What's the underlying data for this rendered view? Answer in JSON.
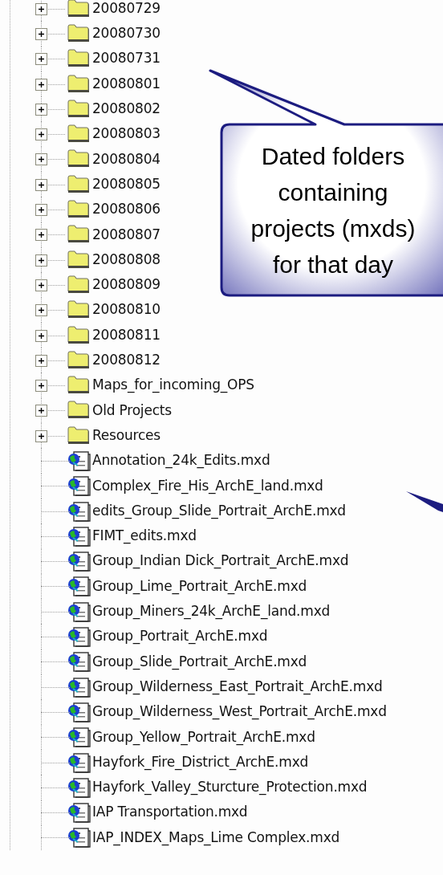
{
  "tree": {
    "items": [
      {
        "kind": "folder",
        "label": "20080729"
      },
      {
        "kind": "folder",
        "label": "20080730"
      },
      {
        "kind": "folder",
        "label": "20080731"
      },
      {
        "kind": "folder",
        "label": "20080801"
      },
      {
        "kind": "folder",
        "label": "20080802"
      },
      {
        "kind": "folder",
        "label": "20080803"
      },
      {
        "kind": "folder",
        "label": "20080804"
      },
      {
        "kind": "folder",
        "label": "20080805"
      },
      {
        "kind": "folder",
        "label": "20080806"
      },
      {
        "kind": "folder",
        "label": "20080807"
      },
      {
        "kind": "folder",
        "label": "20080808"
      },
      {
        "kind": "folder",
        "label": "20080809"
      },
      {
        "kind": "folder",
        "label": "20080810"
      },
      {
        "kind": "folder",
        "label": "20080811"
      },
      {
        "kind": "folder",
        "label": "20080812"
      },
      {
        "kind": "folder",
        "label": "Maps_for_incoming_OPS"
      },
      {
        "kind": "folder",
        "label": "Old Projects"
      },
      {
        "kind": "folder",
        "label": "Resources"
      },
      {
        "kind": "map",
        "label": "Annotation_24k_Edits.mxd"
      },
      {
        "kind": "map",
        "label": "Complex_Fire_His_ArchE_land.mxd"
      },
      {
        "kind": "map",
        "label": "edits_Group_Slide_Portrait_ArchE.mxd"
      },
      {
        "kind": "map",
        "label": "FIMT_edits.mxd"
      },
      {
        "kind": "map",
        "label": "Group_Indian Dick_Portrait_ArchE.mxd"
      },
      {
        "kind": "map",
        "label": "Group_Lime_Portrait_ArchE.mxd"
      },
      {
        "kind": "map",
        "label": "Group_Miners_24k_ArchE_land.mxd"
      },
      {
        "kind": "map",
        "label": "Group_Portrait_ArchE.mxd"
      },
      {
        "kind": "map",
        "label": "Group_Slide_Portrait_ArchE.mxd"
      },
      {
        "kind": "map",
        "label": "Group_Wilderness_East_Portrait_ArchE.mxd"
      },
      {
        "kind": "map",
        "label": "Group_Wilderness_West_Portrait_ArchE.mxd"
      },
      {
        "kind": "map",
        "label": "Group_Yellow_Portrait_ArchE.mxd"
      },
      {
        "kind": "map",
        "label": "Hayfork_Fire_District_ArchE.mxd"
      },
      {
        "kind": "map",
        "label": "Hayfork_Valley_Sturcture_Protection.mxd"
      },
      {
        "kind": "map",
        "label": "IAP Transportation.mxd"
      },
      {
        "kind": "map",
        "label": "IAP_INDEX_Maps_Lime Complex.mxd"
      }
    ]
  },
  "callout": {
    "lines": [
      "Dated folders",
      "containing",
      "projects (mxds)",
      "for that day"
    ]
  }
}
